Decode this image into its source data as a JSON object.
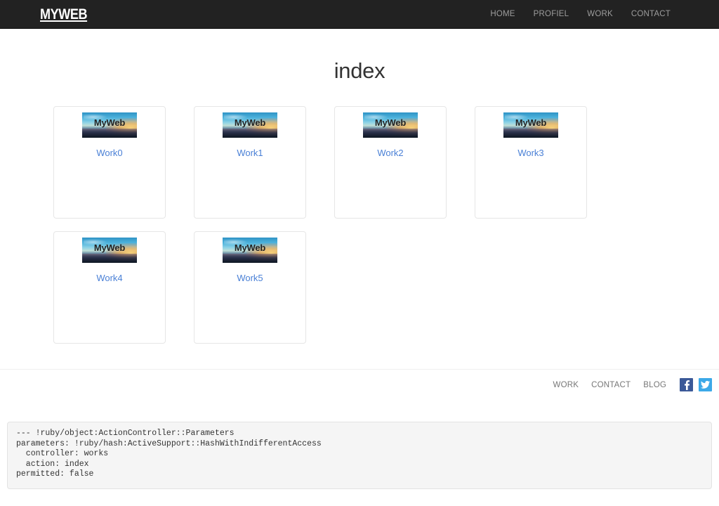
{
  "navbar": {
    "brand": "MYWEB",
    "links": [
      {
        "label": "HOME"
      },
      {
        "label": "PROFIEL"
      },
      {
        "label": "WORK"
      },
      {
        "label": "CONTACT"
      }
    ]
  },
  "main": {
    "title": "index",
    "thumbnail_label": "MyWeb",
    "cards": [
      {
        "label": "Work0"
      },
      {
        "label": "Work1"
      },
      {
        "label": "Work2"
      },
      {
        "label": "Work3"
      },
      {
        "label": "Work4"
      },
      {
        "label": "Work5"
      }
    ]
  },
  "footer": {
    "links": [
      {
        "label": "WORK"
      },
      {
        "label": "CONTACT"
      },
      {
        "label": "BLOG"
      }
    ],
    "social": [
      {
        "name": "facebook-icon",
        "color": "#3b5998"
      },
      {
        "name": "twitter-icon",
        "color": "#3ca9e8"
      }
    ]
  },
  "debug": {
    "text": "--- !ruby/object:ActionController::Parameters\nparameters: !ruby/hash:ActiveSupport::HashWithIndifferentAccess\n  controller: works\n  action: index\npermitted: false"
  },
  "colors": {
    "navbar_bg": "#222222",
    "nav_link": "#9d9d9d",
    "title": "#333333",
    "card_border": "#e6e6e6",
    "card_link": "#4a80d6",
    "footer_link": "#777777",
    "debug_bg": "#f5f5f5"
  }
}
